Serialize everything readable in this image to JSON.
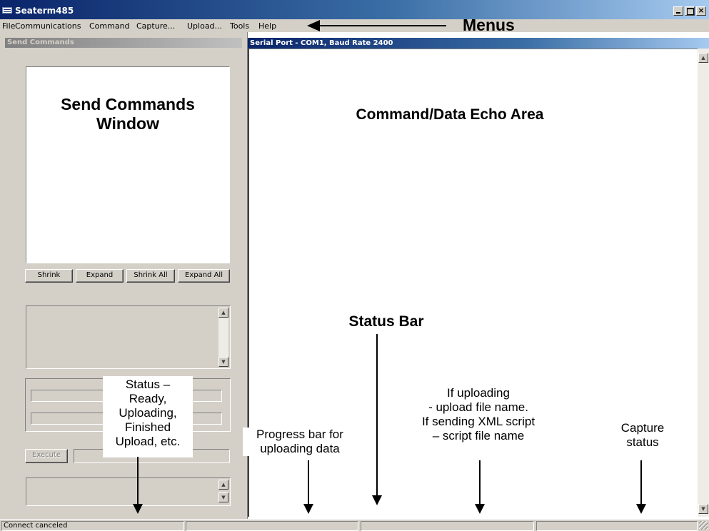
{
  "window": {
    "title": "Seaterm485"
  },
  "menu": [
    "File",
    "Communications",
    "Command",
    "Capture...",
    "Upload...",
    "Tools",
    "Help"
  ],
  "left_panel": {
    "header": "Send Commands",
    "buttons": {
      "shrink": "Shrink",
      "expand": "Expand",
      "shrink_all": "Shrink All",
      "expand_all": "Expand All"
    },
    "execute": "Execute"
  },
  "right_panel": {
    "header": "Serial Port - COM1, Baud Rate 2400"
  },
  "status_bar": {
    "panel1": "Connect canceled"
  },
  "annotations": {
    "menus": "Menus",
    "send_commands_window": "Send Commands\nWindow",
    "echo_area": "Command/Data Echo Area",
    "status_bar": "Status Bar",
    "status_desc": "Status –\nReady,\nUploading,\nFinished\nUpload, etc.",
    "progress_bar": "Progress bar for\nuploading data",
    "upload_info": "If uploading\n- upload file name.\nIf sending XML script\n– script file name",
    "capture_status": "Capture\nstatus"
  }
}
